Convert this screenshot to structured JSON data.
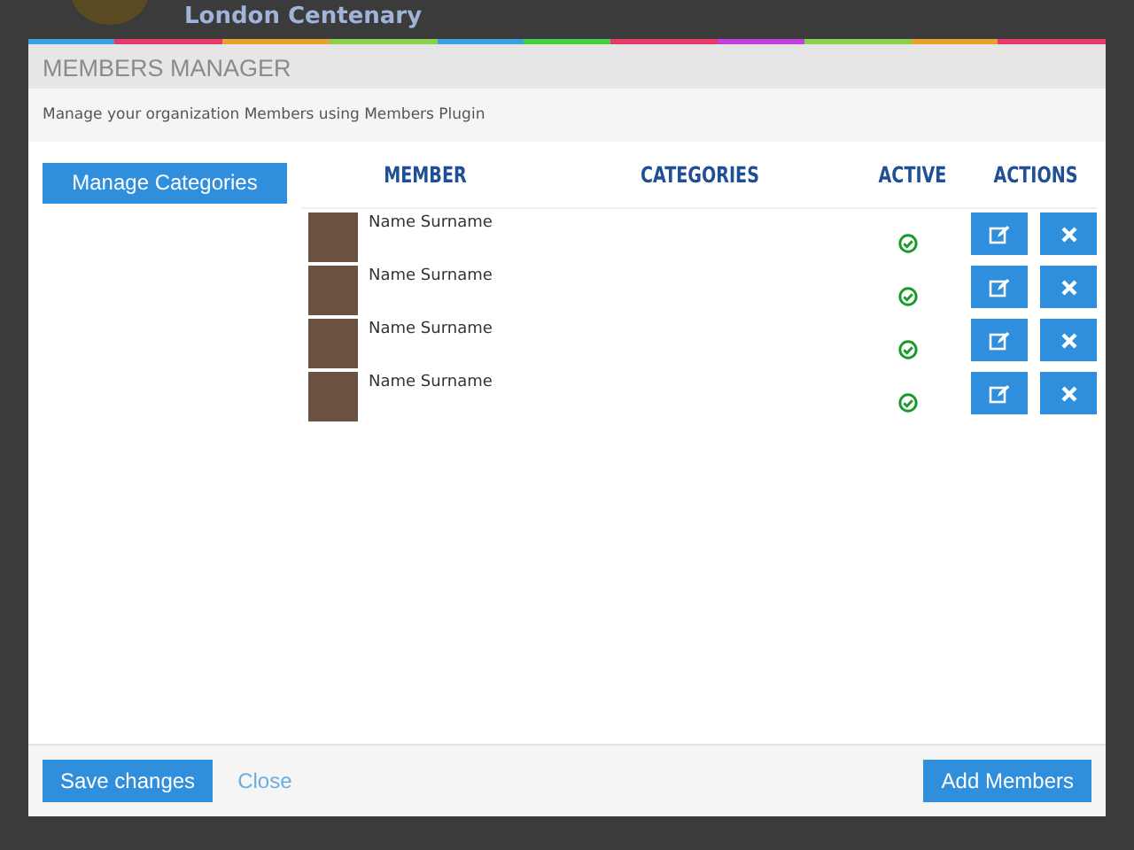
{
  "background": {
    "site_title": "London Centenary"
  },
  "modal": {
    "title": "MEMBERS MANAGER",
    "subtitle": "Manage your organization Members using Members Plugin",
    "manage_button": "Manage Categories",
    "columns": [
      "MEMBER",
      "CATEGORIES",
      "ACTIVE",
      "ACTIONS"
    ],
    "members": [
      {
        "name": "Name Surname",
        "active": true
      },
      {
        "name": "Name Surname",
        "active": true
      },
      {
        "name": "Name Surname",
        "active": true
      },
      {
        "name": "Name Surname",
        "active": true
      }
    ],
    "footer": {
      "save": "Save changes",
      "close": "Close",
      "add": "Add Members"
    }
  }
}
